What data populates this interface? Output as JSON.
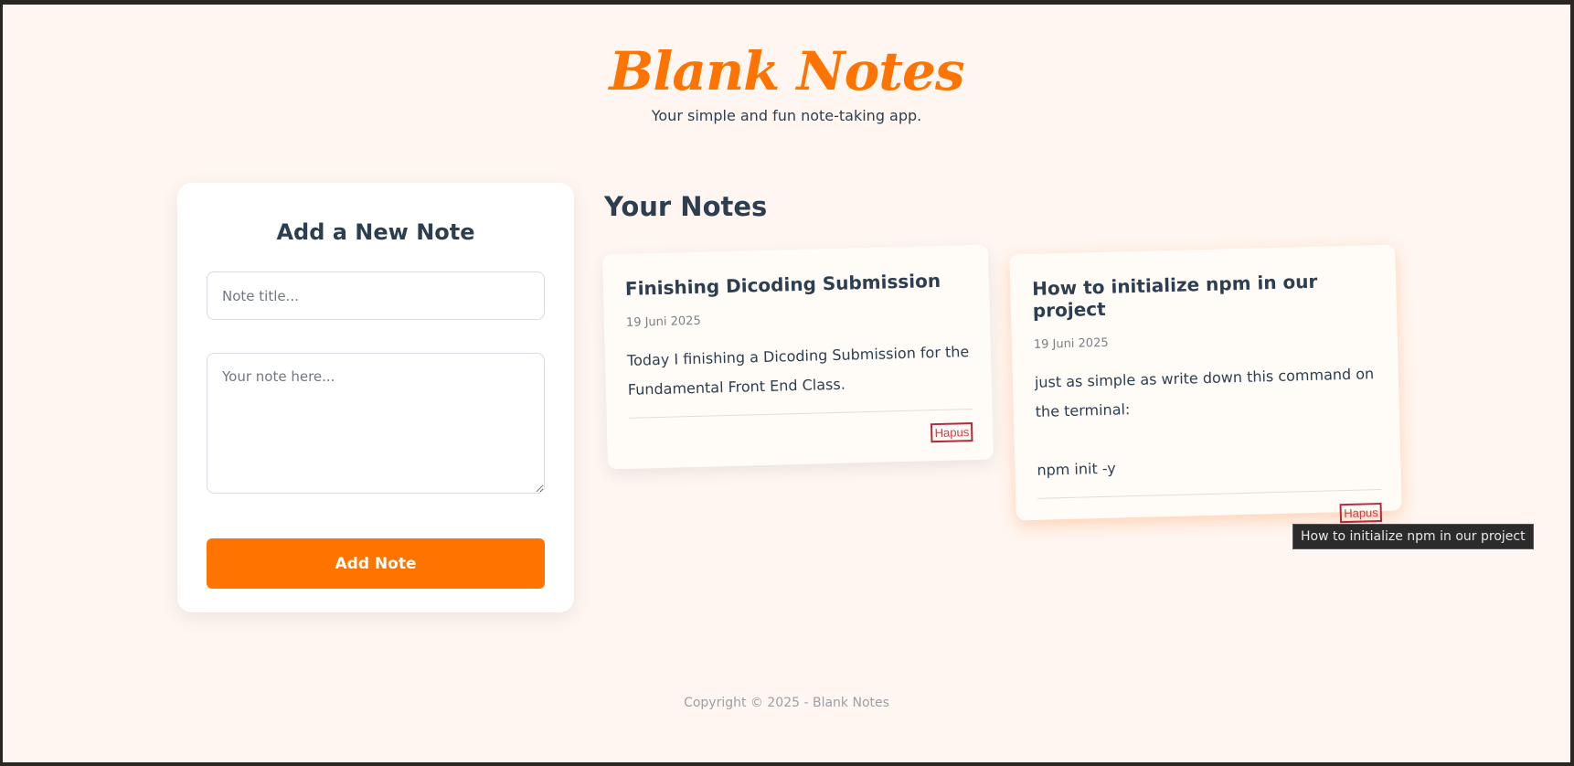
{
  "header": {
    "logo": "Blank Notes",
    "tagline": "Your simple and fun note-taking app."
  },
  "form": {
    "title": "Add a New Note",
    "title_placeholder": "Note title...",
    "body_placeholder": "Your note here...",
    "submit_label": "Add Note"
  },
  "notes_section": {
    "title": "Your Notes",
    "notes": [
      {
        "title": "Finishing Dicoding Submission",
        "date": "19 Juni 2025",
        "body": "Today I finishing a Dicoding Submission for the Fundamental Front End Class.",
        "delete_label": "Hapus"
      },
      {
        "title": "How to initialize npm in our project",
        "date": "19 Juni 2025",
        "body": "just as simple as write down this command on the terminal:\n\nnpm init -y",
        "delete_label": "Hapus"
      }
    ]
  },
  "tooltip": "How to initialize npm in our project",
  "footer": "Copyright © 2025 - Blank Notes",
  "colors": {
    "accent": "#ff7300",
    "text": "#2c3e50",
    "background": "#fff6f1",
    "danger": "#dc3545"
  }
}
